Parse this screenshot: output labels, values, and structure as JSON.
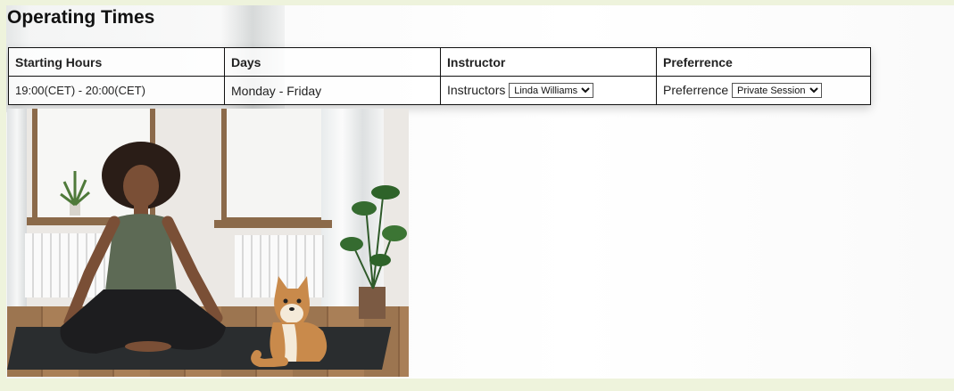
{
  "page": {
    "title": "Operating Times"
  },
  "table": {
    "headers": [
      "Starting Hours",
      "Days",
      "Instructor",
      "Preferrence"
    ],
    "row": {
      "hours": "19:00(CET) - 20:00(CET)",
      "days": "Monday - Friday",
      "instructor_label": "Instructors",
      "instructor_value": "Linda Williams",
      "preference_label": "Preferrence",
      "preference_value": "Private Session"
    }
  },
  "colors": {
    "page_background": "#eef3dc",
    "border": "#111111"
  }
}
